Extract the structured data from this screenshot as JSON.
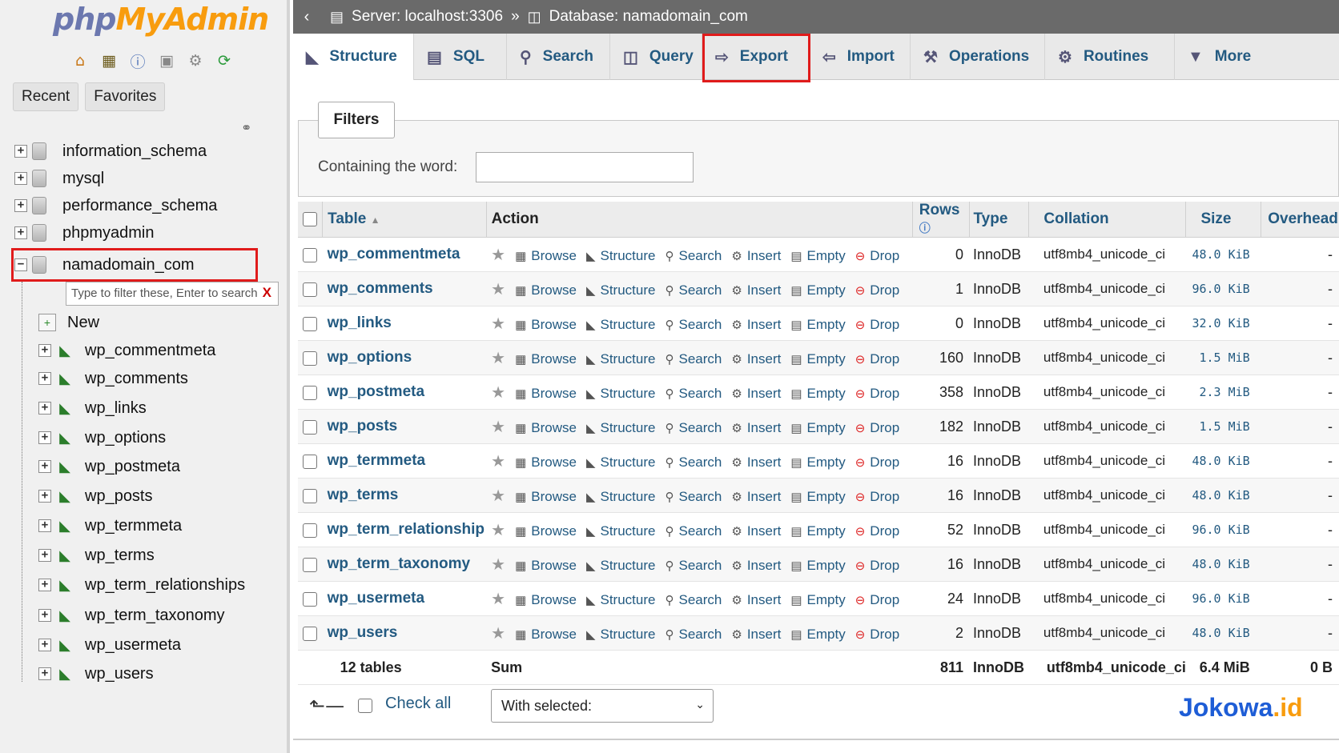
{
  "logo": {
    "php": "php",
    "my": "MyAdmin"
  },
  "logo_icons": [
    "home-icon",
    "database-icon",
    "help-icon",
    "docs-icon",
    "settings-icon",
    "reload-icon"
  ],
  "nav_tabs": {
    "recent": "Recent",
    "favorites": "Favorites"
  },
  "databases": [
    "information_schema",
    "mysql",
    "performance_schema",
    "phpmyadmin",
    "namadomain_com"
  ],
  "nav_filter": {
    "placeholder": "Type to filter these, Enter to search",
    "clear": "X"
  },
  "tree_new": "New",
  "tree_tables": [
    "wp_commentmeta",
    "wp_comments",
    "wp_links",
    "wp_options",
    "wp_postmeta",
    "wp_posts",
    "wp_termmeta",
    "wp_terms",
    "wp_term_relationships",
    "wp_term_taxonomy",
    "wp_usermeta",
    "wp_users"
  ],
  "breadcrumb": {
    "server": "Server: localhost:3306",
    "sep": "»",
    "database": "Database: namadomain_com"
  },
  "main_tabs": [
    "Structure",
    "SQL",
    "Search",
    "Query",
    "Export",
    "Import",
    "Operations",
    "Routines",
    "More"
  ],
  "filters": {
    "legend": "Filters",
    "label": "Containing the word:",
    "value": ""
  },
  "table_headers": {
    "table": "Table",
    "action": "Action",
    "rows": "Rows",
    "type": "Type",
    "collation": "Collation",
    "size": "Size",
    "overhead": "Overhead"
  },
  "action_labels": [
    "Browse",
    "Structure",
    "Search",
    "Insert",
    "Empty",
    "Drop"
  ],
  "rows": [
    {
      "name": "wp_commentmeta",
      "rows": "0",
      "type": "InnoDB",
      "collation": "utf8mb4_unicode_ci",
      "size": "48.0 KiB",
      "overhead": "-"
    },
    {
      "name": "wp_comments",
      "rows": "1",
      "type": "InnoDB",
      "collation": "utf8mb4_unicode_ci",
      "size": "96.0 KiB",
      "overhead": "-"
    },
    {
      "name": "wp_links",
      "rows": "0",
      "type": "InnoDB",
      "collation": "utf8mb4_unicode_ci",
      "size": "32.0 KiB",
      "overhead": "-"
    },
    {
      "name": "wp_options",
      "rows": "160",
      "type": "InnoDB",
      "collation": "utf8mb4_unicode_ci",
      "size": "1.5 MiB",
      "overhead": "-"
    },
    {
      "name": "wp_postmeta",
      "rows": "358",
      "type": "InnoDB",
      "collation": "utf8mb4_unicode_ci",
      "size": "2.3 MiB",
      "overhead": "-"
    },
    {
      "name": "wp_posts",
      "rows": "182",
      "type": "InnoDB",
      "collation": "utf8mb4_unicode_ci",
      "size": "1.5 MiB",
      "overhead": "-"
    },
    {
      "name": "wp_termmeta",
      "rows": "16",
      "type": "InnoDB",
      "collation": "utf8mb4_unicode_ci",
      "size": "48.0 KiB",
      "overhead": "-"
    },
    {
      "name": "wp_terms",
      "rows": "16",
      "type": "InnoDB",
      "collation": "utf8mb4_unicode_ci",
      "size": "48.0 KiB",
      "overhead": "-"
    },
    {
      "name": "wp_term_relationship",
      "rows": "52",
      "type": "InnoDB",
      "collation": "utf8mb4_unicode_ci",
      "size": "96.0 KiB",
      "overhead": "-"
    },
    {
      "name": "wp_term_taxonomy",
      "rows": "16",
      "type": "InnoDB",
      "collation": "utf8mb4_unicode_ci",
      "size": "48.0 KiB",
      "overhead": "-"
    },
    {
      "name": "wp_usermeta",
      "rows": "24",
      "type": "InnoDB",
      "collation": "utf8mb4_unicode_ci",
      "size": "96.0 KiB",
      "overhead": "-"
    },
    {
      "name": "wp_users",
      "rows": "2",
      "type": "InnoDB",
      "collation": "utf8mb4_unicode_ci",
      "size": "48.0 KiB",
      "overhead": "-"
    }
  ],
  "summary": {
    "count": "12 tables",
    "label": "Sum",
    "rows": "811",
    "type": "InnoDB",
    "collation": "utf8mb4_unicode_ci",
    "size": "6.4 MiB",
    "overhead": "0 B"
  },
  "footer": {
    "check_all": "Check all",
    "with_selected": "With selected:"
  },
  "brand": {
    "name": "Jokowa",
    "tld": ".id"
  },
  "colors": {
    "link": "#235a81",
    "highlight": "#e01b1b",
    "topbar": "#6a6a6a",
    "logo_php": "#6c78af",
    "logo_my": "#f89c0e"
  }
}
